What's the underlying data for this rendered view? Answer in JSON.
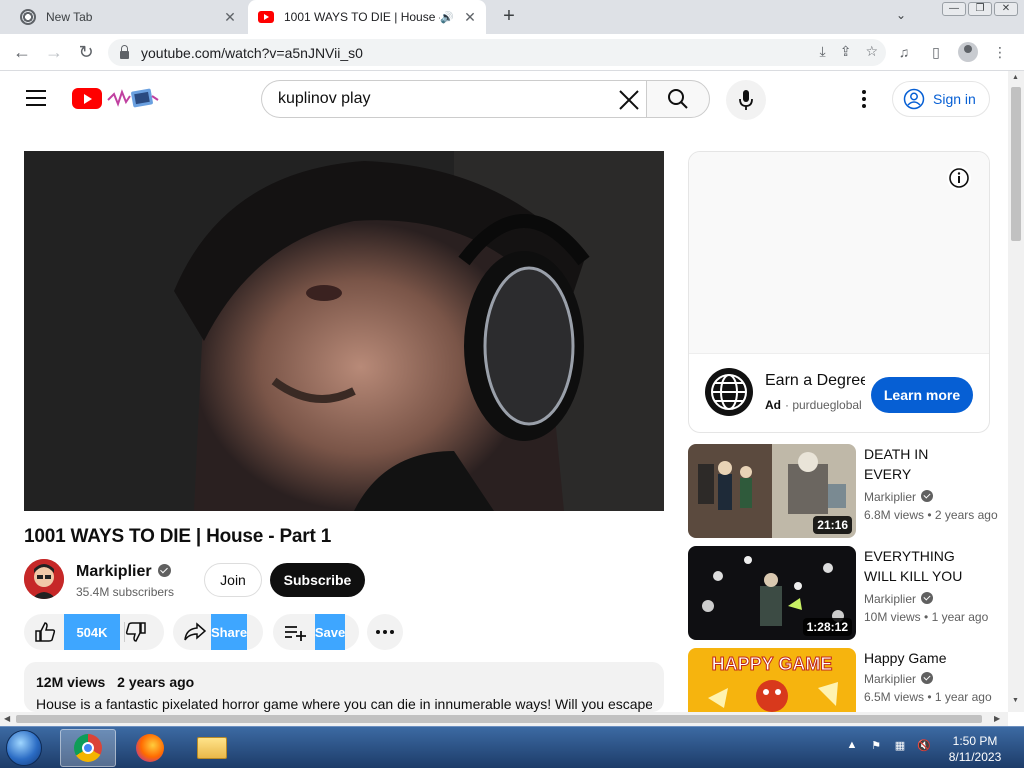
{
  "browser": {
    "tabs": [
      {
        "title": "New Tab",
        "active": false
      },
      {
        "title": "1001 WAYS TO DIE | House -",
        "active": true
      }
    ],
    "tab_close_glyph": "✕",
    "new_tab_glyph": "+",
    "url": "youtube.com/watch?v=a5nJNVii_s0"
  },
  "header": {
    "search_query": "kuplinov play",
    "signin_label": "Sign in"
  },
  "video": {
    "title": "1001 WAYS TO DIE | House - Part 1",
    "channel": "Markiplier",
    "subscribers": "35.4M subscribers",
    "join_label": "Join",
    "subscribe_label": "Subscribe",
    "likes": "504K",
    "share_label": "Share",
    "save_label": "Save",
    "views": "12M views",
    "age": "2 years ago",
    "description": "House is a fantastic pixelated horror game where you can die in innumerable ways! Will you escape"
  },
  "ad": {
    "title": "Earn a Degree",
    "ad_tag": "Ad",
    "sponsor": "· purdueglobal",
    "cta_label": "Learn more"
  },
  "recommendations": [
    {
      "title": "DEATH IN EVERY CORNER",
      "channel": "Markiplier",
      "views": "6.8M views",
      "age": "• 2 years ago",
      "duration": "21:16"
    },
    {
      "title": "EVERYTHING WILL KILL YOU",
      "channel": "Markiplier",
      "views": "10M views",
      "age": "• 1 year ago",
      "duration": "1:28:12"
    },
    {
      "title": "Happy Game",
      "channel": "Markiplier",
      "views": "6.5M views",
      "age": "• 1 year ago",
      "duration": "",
      "thumb_text": "HAPPY GAME"
    }
  ],
  "taskbar": {
    "time": "1:50 PM",
    "date": "8/11/2023"
  },
  "colors": {
    "yt_red": "#ff0000",
    "link_blue": "#065fd4",
    "highlight_blue": "#3ea6ff",
    "chip_gray": "#f2f2f2"
  },
  "icons": [
    "chrome-icon",
    "youtube-favicon",
    "speaker-icon",
    "close-icon",
    "back-icon",
    "forward-icon",
    "reload-icon",
    "lock-icon",
    "install-icon",
    "share-page-icon",
    "star-icon",
    "media-icon",
    "sidepanel-icon",
    "profile-icon",
    "menu-icon",
    "search-icon",
    "clear-icon",
    "mic-icon",
    "more-icon",
    "account-icon",
    "verified-icon",
    "like-icon",
    "dislike-icon",
    "share-icon",
    "save-icon",
    "info-icon"
  ]
}
